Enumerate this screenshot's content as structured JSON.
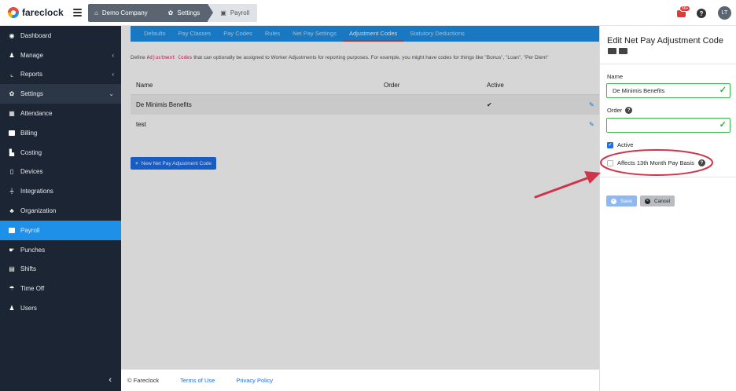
{
  "brand": {
    "name": "fareclock"
  },
  "breadcrumb": [
    {
      "label": "Demo Company",
      "icon": "home-icon"
    },
    {
      "label": "Settings",
      "icon": "gear-icon"
    },
    {
      "label": "Payroll",
      "icon": "payroll-icon"
    }
  ],
  "header": {
    "notification_badge": "56+",
    "help": "?",
    "avatar_initials": "LT"
  },
  "sidebar": {
    "items": [
      {
        "label": "Dashboard",
        "icon": "dashboard-icon"
      },
      {
        "label": "Manage",
        "icon": "person-icon",
        "chevron": "‹"
      },
      {
        "label": "Reports",
        "icon": "chart-icon",
        "chevron": "‹"
      },
      {
        "label": "Settings",
        "icon": "gear-icon",
        "chevron": "⌄"
      },
      {
        "label": "Attendance",
        "icon": "calendar-icon"
      },
      {
        "label": "Billing",
        "icon": "card-icon"
      },
      {
        "label": "Costing",
        "icon": "factory-icon"
      },
      {
        "label": "Devices",
        "icon": "device-icon"
      },
      {
        "label": "Integrations",
        "icon": "plug-icon"
      },
      {
        "label": "Organization",
        "icon": "org-icon"
      },
      {
        "label": "Payroll",
        "icon": "money-icon"
      },
      {
        "label": "Punches",
        "icon": "punch-icon"
      },
      {
        "label": "Shifts",
        "icon": "shift-icon"
      },
      {
        "label": "Time Off",
        "icon": "umbrella-icon"
      },
      {
        "label": "Users",
        "icon": "users-icon"
      }
    ],
    "collapse_glyph": "‹"
  },
  "tabs": [
    "Defaults",
    "Pay Classes",
    "Pay Codes",
    "Rules",
    "Net Pay Settings",
    "Adjustment Codes",
    "Statutory Deductions"
  ],
  "content": {
    "description_pre": "Define ",
    "description_code": "Adjustment Codes",
    "description_post": " that can optionally be assigned to Worker Adjustments for reporting purposes. For example, you might have codes for things like \"Bonus\", \"Loan\", \"Per Diem\"",
    "columns": {
      "name": "Name",
      "order": "Order",
      "active": "Active"
    },
    "rows": [
      {
        "name": "De Minimis Benefits",
        "order": "",
        "active": "✔"
      },
      {
        "name": "test",
        "order": "",
        "active": ""
      }
    ],
    "new_button": "New Net Pay Adjustment Code"
  },
  "footer": {
    "copyright": "© Fareclock",
    "terms": "Terms of Use",
    "privacy": "Privacy Policy"
  },
  "panel": {
    "title": "Edit Net Pay Adjustment Code",
    "name_label": "Name",
    "name_value": "De Minimis Benefits",
    "order_label": "Order",
    "order_value": "",
    "active_label": "Active",
    "affects_label": "Affects 13th Month Pay Basis",
    "save": "Save",
    "cancel": "Cancel"
  },
  "colors": {
    "sidebar": "#1b2533",
    "accent": "#1e90e8",
    "annotation": "#d0344a",
    "valid": "#3bb54a"
  }
}
